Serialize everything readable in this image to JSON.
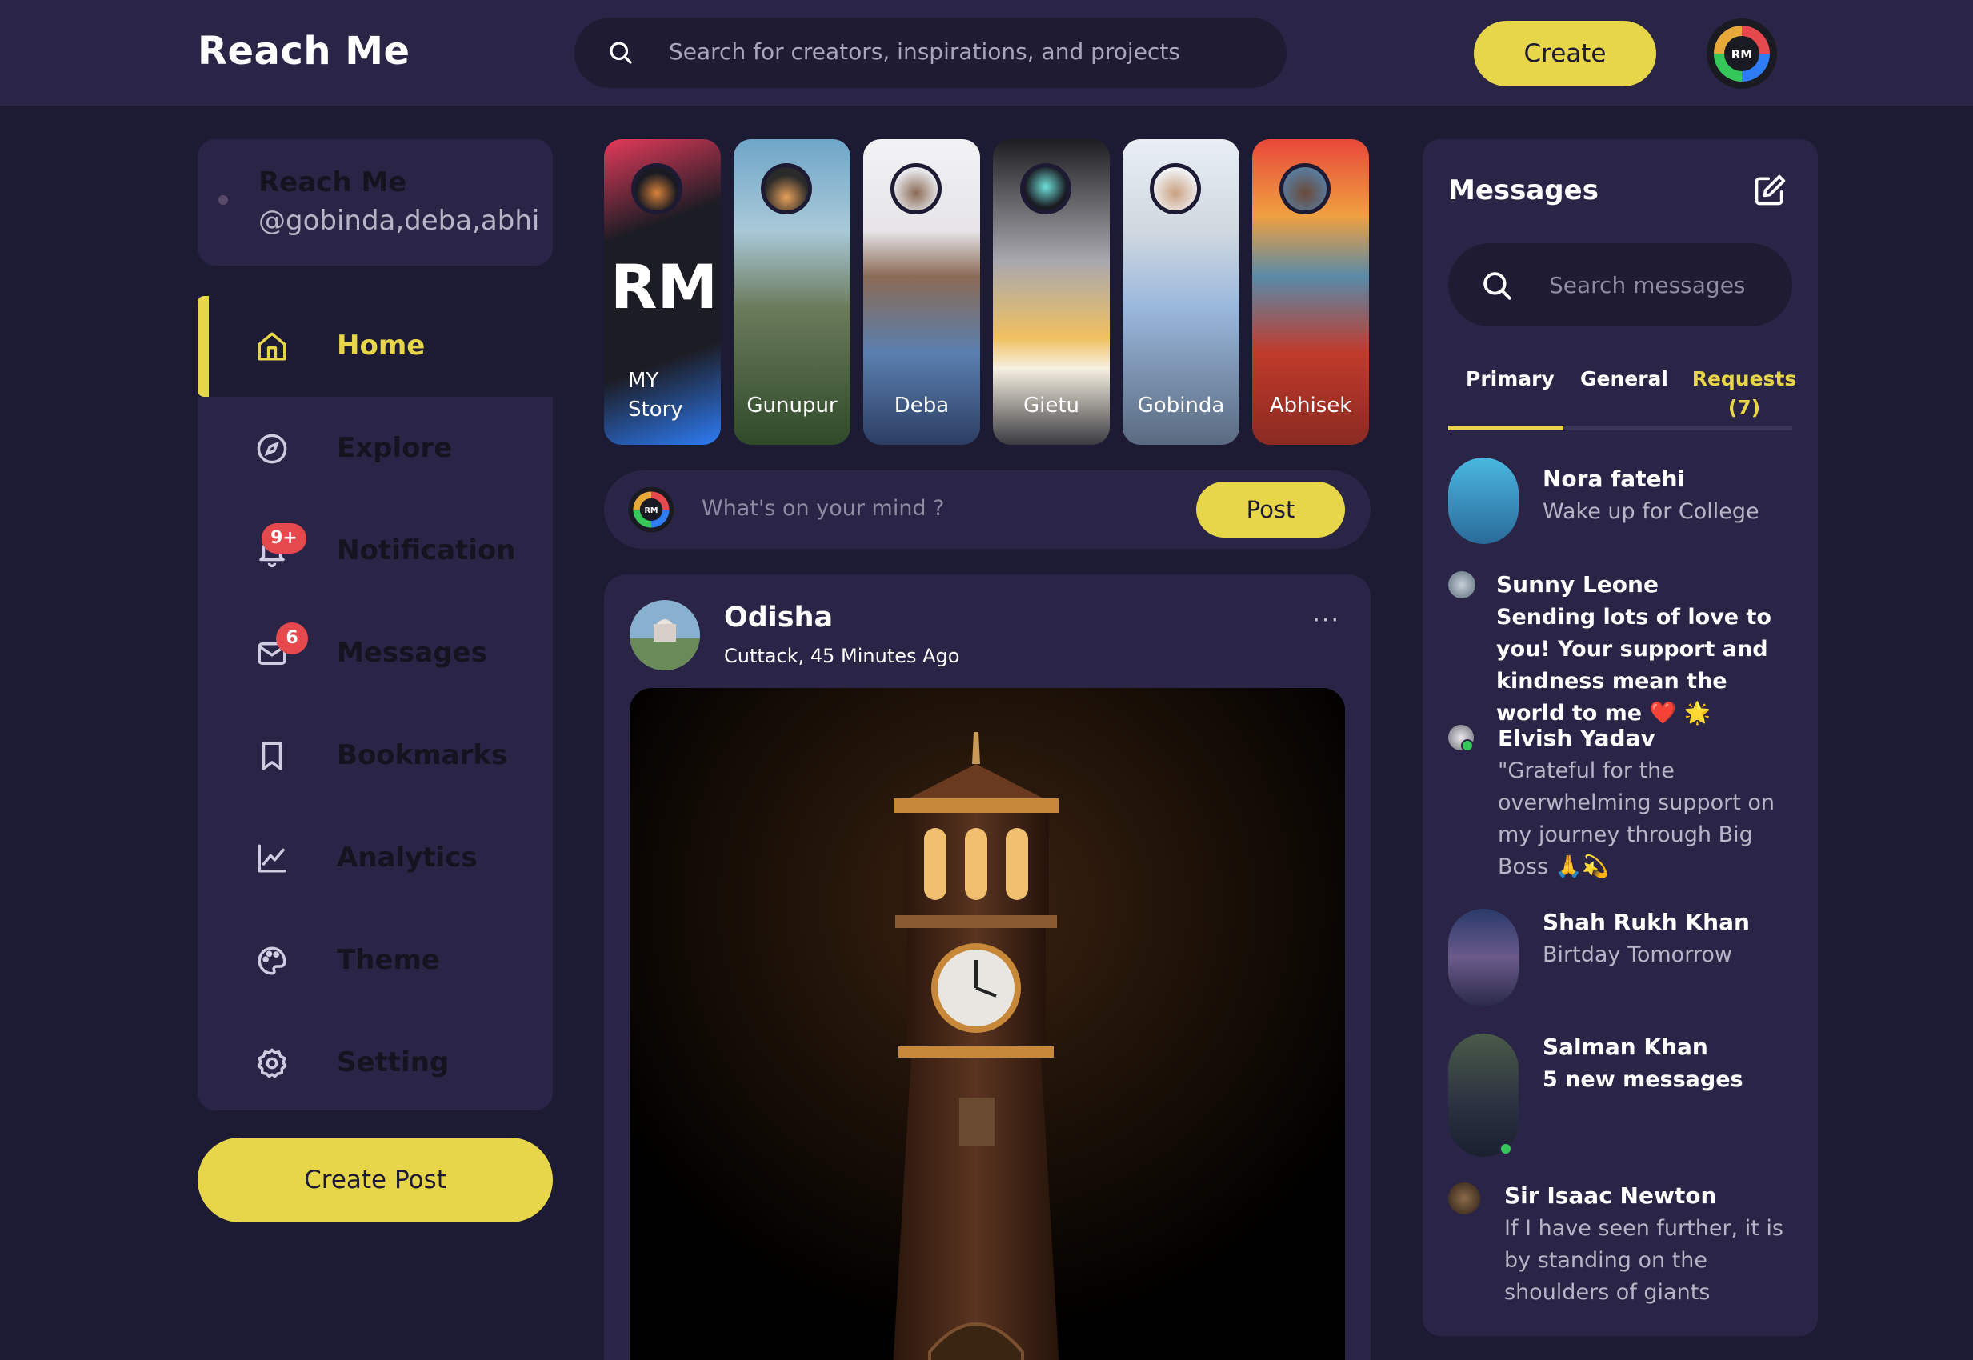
{
  "app": {
    "name": "Reach Me"
  },
  "topnav": {
    "search_placeholder": "Search for creators, inspirations, and projects",
    "create_label": "Create",
    "avatar_initials": "RM"
  },
  "profile": {
    "name": "Reach Me",
    "handle": "@gobinda,deba,abhi"
  },
  "sidebar": {
    "items": [
      {
        "label": "Home",
        "icon": "home-icon",
        "active": true
      },
      {
        "label": "Explore",
        "icon": "compass-icon"
      },
      {
        "label": "Notification",
        "icon": "bell-icon",
        "badge": "9+"
      },
      {
        "label": "Messages",
        "icon": "mail-icon",
        "badge": "6"
      },
      {
        "label": "Bookmarks",
        "icon": "bookmark-icon"
      },
      {
        "label": "Analytics",
        "icon": "chart-line-icon"
      },
      {
        "label": "Theme",
        "icon": "palette-icon"
      },
      {
        "label": "Setting",
        "icon": "gear-icon"
      }
    ],
    "create_post_label": "Create Post"
  },
  "stories": [
    {
      "line1": "MY",
      "line2": "Story",
      "big": "RM"
    },
    {
      "name": "Gunupur"
    },
    {
      "name": "Deba"
    },
    {
      "name": "Gietu"
    },
    {
      "name": "Gobinda"
    },
    {
      "name": "Abhisek"
    }
  ],
  "composer": {
    "placeholder": "What's on your mind ?",
    "post_label": "Post"
  },
  "post": {
    "title": "Odisha",
    "subtitle": "Cuttack, 45 Minutes Ago",
    "more": "···"
  },
  "messages": {
    "title": "Messages",
    "search_placeholder": "Search messages",
    "tabs": {
      "primary": "Primary",
      "general": "General",
      "requests": "Requests",
      "requests_count": "(7)"
    },
    "items": [
      {
        "name": "Nora fatehi",
        "text": "Wake up for College"
      },
      {
        "name": "Sunny Leone",
        "text": "Sending lots of love to you! Your support and kindness mean the world to me ❤️ 🌟"
      },
      {
        "name": "Elvish Yadav",
        "text": "\"Grateful for the overwhelming support on my journey through Big Boss 🙏💫"
      },
      {
        "name": "Shah Rukh Khan",
        "text": "Birtday Tomorrow"
      },
      {
        "name": "Salman Khan",
        "text": "5 new messages"
      },
      {
        "name": "Sir Isaac Newton",
        "text": "If I have seen further, it is by standing on the shoulders of giants"
      }
    ]
  },
  "colors": {
    "accent": "#e7d54a",
    "bg": "#1d1a34",
    "panel": "#2a2546",
    "badge": "#e5484d"
  }
}
